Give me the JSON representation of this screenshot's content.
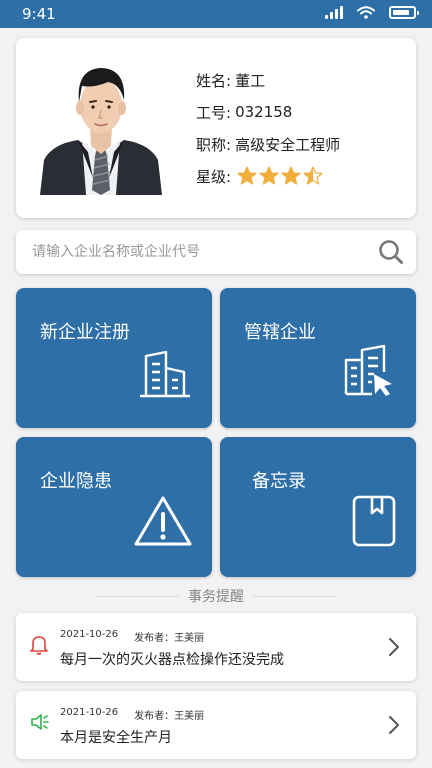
{
  "status_bar": {
    "time": "9:41"
  },
  "profile": {
    "name_label": "姓名:",
    "name": "董工",
    "id_label": "工号:",
    "id": "032158",
    "title_label": "职称:",
    "title": "高级安全工程师",
    "rating_label": "星级:",
    "rating": 3.5,
    "rating_max": 5
  },
  "search": {
    "placeholder": "请输入企业名称或企业代号"
  },
  "tiles": [
    {
      "label": "新企业注册",
      "icon": "building-icon"
    },
    {
      "label": "管辖企业",
      "icon": "building-select-icon"
    },
    {
      "label": "企业隐患",
      "icon": "warning-icon"
    },
    {
      "label": "备忘录",
      "icon": "bookmark-icon"
    }
  ],
  "reminders": {
    "title": "事务提醒",
    "items": [
      {
        "date": "2021-10-26",
        "publisher": "发布者：王美丽",
        "message": "每月一次的灭火器点检操作还没完成",
        "icon": "bell-icon",
        "icon_color": "#e0443b"
      },
      {
        "date": "2021-10-26",
        "publisher": "发布者：王美丽",
        "message": "本月是安全生产月",
        "icon": "speaker-icon",
        "icon_color": "#2db14a"
      }
    ]
  },
  "colors": {
    "primary": "#2f6fa7",
    "star": "#f1ae3d",
    "background": "#f2f2f2"
  }
}
